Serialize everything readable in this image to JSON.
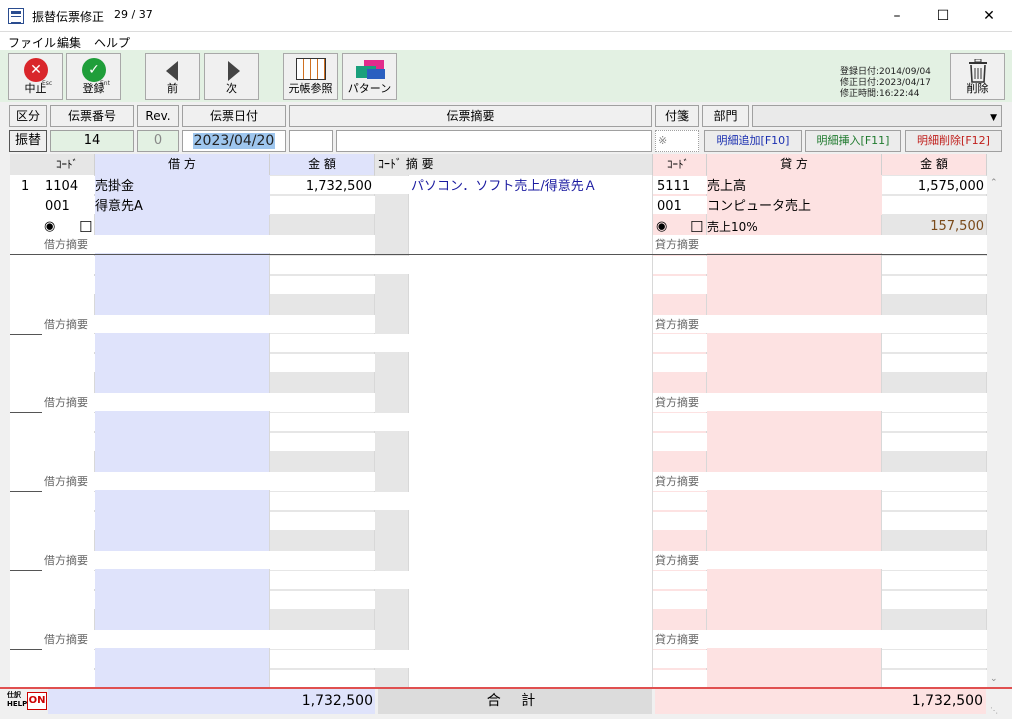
{
  "window": {
    "title": "振替伝票修正",
    "count": "29 / 37",
    "min_icon": "minimize-icon",
    "max_icon": "maximize-icon",
    "close_icon": "close-icon"
  },
  "menu": [
    "ファイル",
    "編集",
    "ヘルプ"
  ],
  "toolbar": {
    "cancel": {
      "label": "中止",
      "key": "Esc",
      "icon": "cancel-circle-icon"
    },
    "register": {
      "label": "登録",
      "key": "Ent",
      "icon": "check-circle-icon"
    },
    "prev": {
      "label": "前",
      "icon": "triangle-left-icon"
    },
    "next": {
      "label": "次",
      "icon": "triangle-right-icon"
    },
    "ledger": {
      "label": "元帳参照",
      "icon": "ledger-grid-icon"
    },
    "pattern": {
      "label": "パターン",
      "icon": "pattern-cards-icon"
    },
    "delete": {
      "label": "削除",
      "icon": "trash-icon"
    }
  },
  "reg_info": {
    "registered": "登録日付:2014/09/04",
    "modified": "修正日付:2023/04/17",
    "mod_time": "修正時間:16:22:44"
  },
  "header": {
    "labels": {
      "kubun": "区分",
      "number": "伝票番号",
      "rev": "Rev.",
      "date": "伝票日付",
      "summary": "伝票摘要",
      "fusen": "付箋",
      "bumon": "部門"
    },
    "values": {
      "kubun": "振替",
      "number": "14",
      "rev": "0",
      "date": "2023/04/20",
      "fusen": "※"
    },
    "buttons": {
      "add": "明細追加[F10]",
      "insert": "明細挿入[F11]",
      "delete": "明細削除[F12]"
    }
  },
  "columns": {
    "code": "ｺｰﾄﾞ",
    "debit": "借 方",
    "amount": "金 額",
    "summary_code": "ｺｰﾄﾞ 摘 要",
    "credit": "貸 方"
  },
  "lines": [
    {
      "no": "1",
      "debit": {
        "code": "1104",
        "name": "売掛金",
        "sub_code": "001",
        "sub_name": "得意先A",
        "amount": "1,732,500",
        "memo_label": "借方摘要"
      },
      "summary": "パソコン．ソフト売上/得意先Ａ",
      "credit": {
        "code": "5111",
        "name": "売上高",
        "sub_code": "001",
        "sub_name": "コンピュータ売上",
        "amount": "1,575,000",
        "tax_label": "売上10%",
        "tax_amount": "157,500",
        "memo_label": "貸方摘要"
      }
    }
  ],
  "memo_labels": {
    "debit": "借方摘要",
    "credit": "貸方摘要"
  },
  "footer": {
    "help": "HELP",
    "on": "ON",
    "debit_total": "1,732,500",
    "total_label": "合 計",
    "credit_total": "1,732,500"
  },
  "colors": {
    "debit_bg": "#dfe3fb",
    "credit_bg": "#fde2e2",
    "amount_bg": "#e6e6e6",
    "toolbar_bg": "#e3f1e3"
  }
}
